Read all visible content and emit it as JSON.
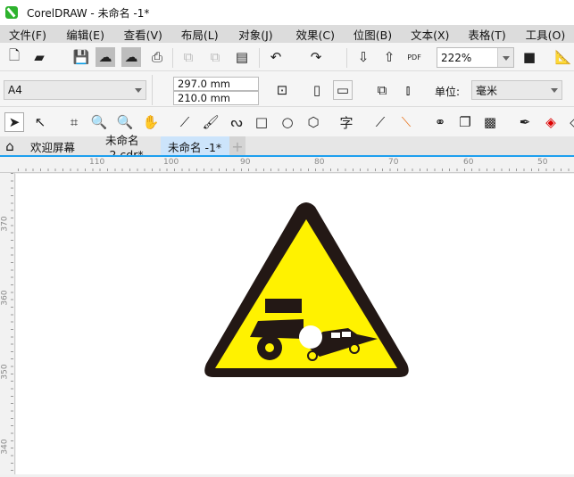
{
  "window": {
    "title": "CorelDRAW - 未命名 -1*"
  },
  "menu": [
    "文件(F)",
    "编辑(E)",
    "查看(V)",
    "布局(L)",
    "对象(J)",
    "效果(C)",
    "位图(B)",
    "文本(X)",
    "表格(T)",
    "工具(O)"
  ],
  "toolbar": {
    "zoom": "222%",
    "pdf_label": "PDF"
  },
  "property_bar": {
    "page_size": "A4",
    "height": "297.0 mm",
    "width": "210.0 mm",
    "unit_label": "单位:",
    "unit": "毫米"
  },
  "tabs": [
    {
      "label": "欢迎屏幕"
    },
    {
      "label": "未命名 -2.cdr*"
    },
    {
      "label": "未命名 -1*",
      "active": true
    }
  ],
  "ruler": {
    "horizontal": [
      "110",
      "100",
      "90",
      "80",
      "70",
      "60",
      "50"
    ],
    "vertical": [
      "370",
      "360",
      "350",
      "340"
    ]
  },
  "colors": {
    "accent": "#1ea0ef",
    "sign_yellow": "#fff200",
    "sign_border": "#231815"
  }
}
